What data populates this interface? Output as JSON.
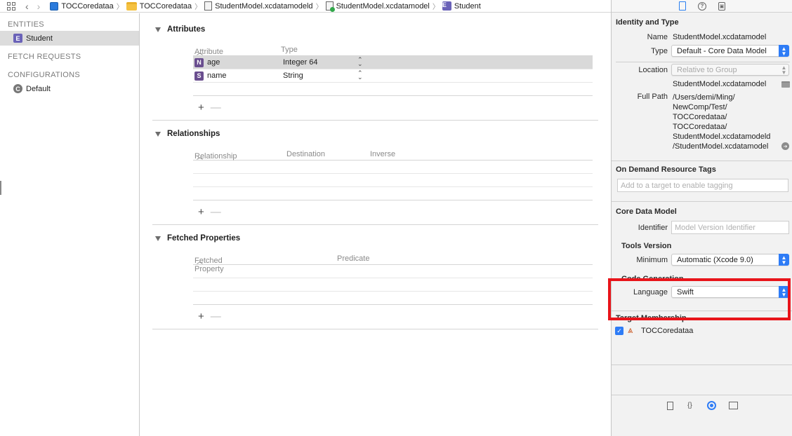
{
  "jumpbar": {
    "crumbs": [
      "TOCCoredataa",
      "TOCCoredataa",
      "StudentModel.xcdatamodeld",
      "StudentModel.xcdatamodel",
      "Student"
    ]
  },
  "navigator": {
    "entities_header": "ENTITIES",
    "entities": [
      "Student"
    ],
    "fetch_header": "FETCH REQUESTS",
    "config_header": "CONFIGURATIONS",
    "configurations": [
      "Default"
    ],
    "entity_badge": "E",
    "config_badge": "C"
  },
  "editor": {
    "attributes": {
      "title": "Attributes",
      "col_attribute": "Attribute",
      "col_type": "Type",
      "rows": [
        {
          "badge": "N",
          "name": "age",
          "type": "Integer 64"
        },
        {
          "badge": "S",
          "name": "name",
          "type": "String"
        }
      ]
    },
    "relationships": {
      "title": "Relationships",
      "col_relationship": "Relationship",
      "col_destination": "Destination",
      "col_inverse": "Inverse"
    },
    "fetched": {
      "title": "Fetched Properties",
      "col_property": "Fetched Property",
      "col_predicate": "Predicate"
    },
    "add_symbol": "+",
    "remove_symbol": "—"
  },
  "inspector": {
    "identity": {
      "title": "Identity and Type",
      "name_label": "Name",
      "name_value": "StudentModel.xcdatamodel",
      "type_label": "Type",
      "type_value": "Default - Core Data Model",
      "location_label": "Location",
      "location_value": "Relative to Group",
      "location_file": "StudentModel.xcdatamodel",
      "fullpath_label": "Full Path",
      "fullpath_lines": [
        "/Users/demi/Ming/",
        "NewComp/Test/",
        "TOCCoredataa/",
        "TOCCoredataa/",
        "StudentModel.xcdatamodeld",
        "/StudentModel.xcdatamodel"
      ]
    },
    "tags": {
      "title": "On Demand Resource Tags",
      "placeholder": "Add to a target to enable tagging"
    },
    "coredata": {
      "title": "Core Data Model",
      "identifier_label": "Identifier",
      "identifier_placeholder": "Model Version Identifier",
      "tools_title": "Tools Version",
      "minimum_label": "Minimum",
      "minimum_value": "Automatic (Xcode 9.0)",
      "codegen_title": "Code Generation",
      "language_label": "Language",
      "language_value": "Swift"
    },
    "membership": {
      "title": "Target Membership",
      "target": "TOCCoredataa",
      "checked": true
    }
  },
  "colors": {
    "accent": "#2e7cf6",
    "highlight_box": "#e8141a",
    "entity_badge": "#6a62b8",
    "attribute_badge": "#6a4e8f"
  }
}
